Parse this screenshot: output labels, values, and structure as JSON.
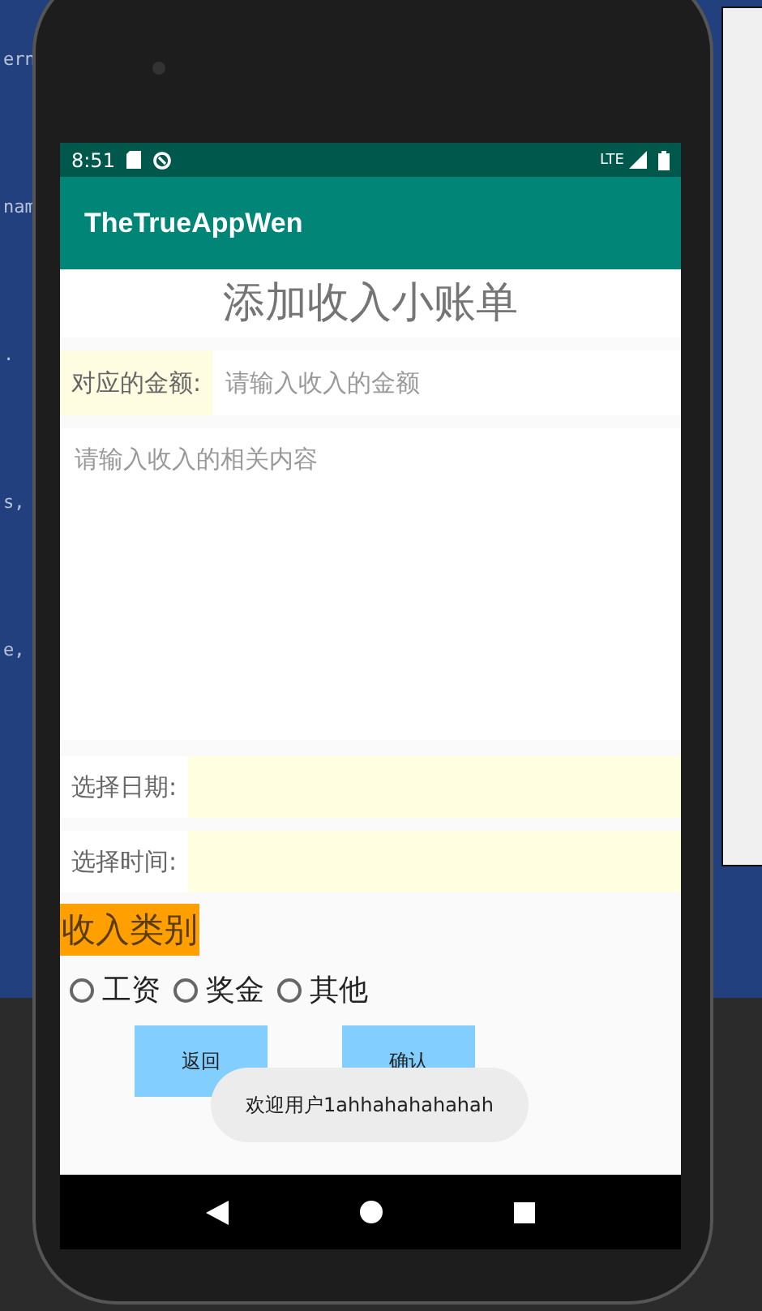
{
  "ide_code_fragments": [
    "ern",
    "nam",
    ".",
    "s,",
    "e,"
  ],
  "status_bar": {
    "time": "8:51",
    "network": "LTE"
  },
  "app_bar": {
    "title": "TheTrueAppWen"
  },
  "heading": "添加收入小账单",
  "amount": {
    "label": "对应的金额:",
    "placeholder": "请输入收入的金额"
  },
  "content": {
    "placeholder": "请输入收入的相关内容"
  },
  "date": {
    "label": "选择日期:"
  },
  "time": {
    "label": "选择时间:"
  },
  "category": {
    "title": "收入类别",
    "options": [
      {
        "label": "工资",
        "selected": false
      },
      {
        "label": "奖金",
        "selected": false
      },
      {
        "label": "其他",
        "selected": false
      }
    ]
  },
  "buttons": [
    "返回",
    "确认"
  ],
  "toast": "欢迎用户1ahhahahahahah"
}
